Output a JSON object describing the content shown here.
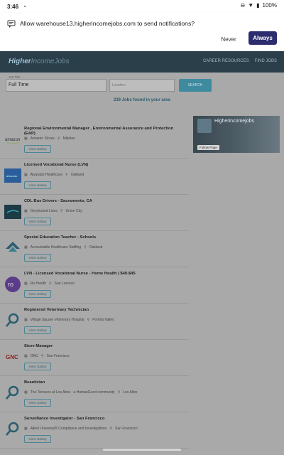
{
  "status_bar": {
    "time": "3:46",
    "battery": "100%"
  },
  "notification": {
    "message": "Allow warehouse13.higherincomejobs.com to send notifications?",
    "never": "Never",
    "always": "Always"
  },
  "header": {
    "logo_main": "Higher",
    "logo_sub": "IncomeJobs",
    "nav": [
      "CAREER RESOURCES",
      "FIND JOBS"
    ]
  },
  "search": {
    "what_label": "Job Title",
    "what_value": "Full Time",
    "where_placeholder": "Location",
    "button": "SEARCH",
    "count_text": "239 Jobs found in your area"
  },
  "facebook": {
    "title": "Higherincomejobs",
    "follow": "Follow Page"
  },
  "jobs": [
    {
      "title": "Regional Environmental Manager , Environmental Assurance and Protection (EAP)",
      "company": "Amazon Stores",
      "location": "Milpitas",
      "salary": "View Salary",
      "icon": "amazon-logo"
    },
    {
      "title": "Licensed Vocational Nurse (LVN)",
      "company": "Alvarado Healthcare",
      "location": "Oakland",
      "salary": "View Salary",
      "icon": "healthcare-logo"
    },
    {
      "title": "CDL Bus Drivers - Sacramento, CA",
      "company": "Greyhound Lines",
      "location": "Union City",
      "salary": "View Salary",
      "icon": "greyhound-logo"
    },
    {
      "title": "Special Education Teacher - Schools",
      "company": "Accountable Healthcare Staffing",
      "location": "Oakland",
      "salary": "View Salary",
      "icon": "ahs-logo"
    },
    {
      "title": "LVN - Licensed Vocational Nurse - Home Health | $40-$45",
      "company": "Ro Health",
      "location": "San Lorenzo",
      "salary": "View Salary",
      "icon": "ro-health-logo"
    },
    {
      "title": "Registered Veterinary Technician",
      "company": "Village Square Veterinary Hospital",
      "location": "Portola Valley",
      "salary": "View Salary",
      "icon": "hij-logo"
    },
    {
      "title": "Store Manager",
      "company": "GNC",
      "location": "San Francisco",
      "salary": "View Salary",
      "icon": "gnc-logo"
    },
    {
      "title": "Beautician",
      "company": "The Terraces at Los Altos - a HumanGood community",
      "location": "Los Altos",
      "salary": "View Salary",
      "icon": "hij-logo"
    },
    {
      "title": "Surveillance Investigator - San Francisco",
      "company": "Allied Universal® Compliance and Investigations",
      "location": "San Francisco",
      "salary": "View Salary",
      "icon": "hij-logo"
    }
  ]
}
